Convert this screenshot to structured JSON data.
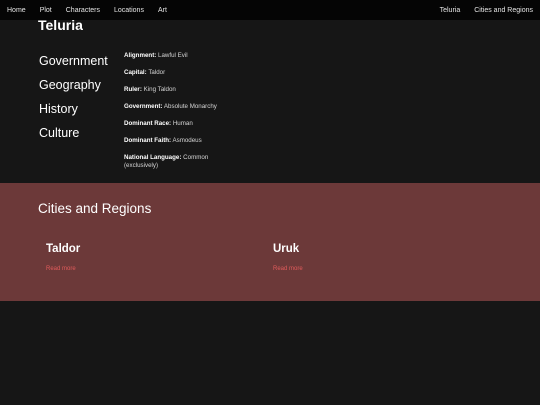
{
  "nav": {
    "left_items": [
      "Home",
      "Plot",
      "Characters",
      "Locations",
      "Art"
    ],
    "right_items": [
      "Teluria",
      "Cities and Regions"
    ]
  },
  "page": {
    "title": "Teluria"
  },
  "topics": [
    "Government",
    "Geography",
    "History",
    "Culture"
  ],
  "facts": [
    {
      "label": "Alignment:",
      "value": "Lawful Evil"
    },
    {
      "label": "Capital:",
      "value": "Taldor"
    },
    {
      "label": "Ruler:",
      "value": "King Taldon"
    },
    {
      "label": "Government:",
      "value": "Absolute Monarchy"
    },
    {
      "label": "Dominant Race:",
      "value": "Human"
    },
    {
      "label": "Dominant Faith:",
      "value": "Asmodeus"
    },
    {
      "label": "National Language:",
      "value": "Common (exclusively)"
    }
  ],
  "regions": {
    "heading": "Cities and Regions",
    "cities": [
      {
        "name": "Taldor",
        "link": "Read more"
      },
      {
        "name": "Uruk",
        "link": "Read more"
      }
    ]
  },
  "colors": {
    "navbar_bg": "#050505",
    "page_bg": "#161616",
    "regions_bg": "#6c3939",
    "link": "#e05b5b"
  }
}
